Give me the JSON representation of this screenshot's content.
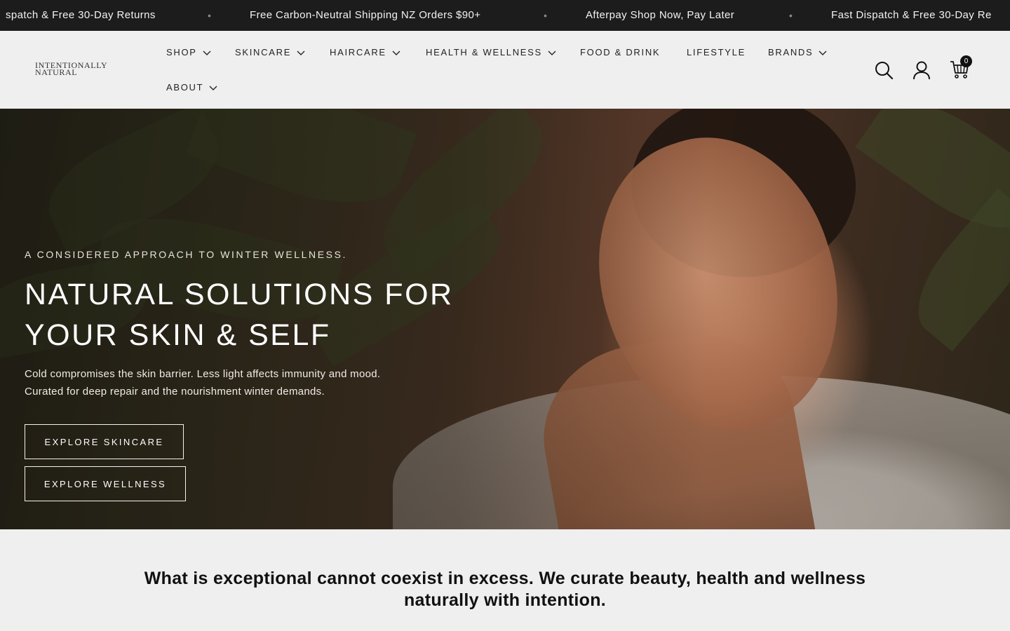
{
  "announcement": {
    "items": [
      "spatch & Free 30-Day Returns",
      "Free Carbon-Neutral Shipping NZ Orders $90+",
      "Afterpay Shop Now, Pay Later",
      "Fast Dispatch & Free 30-Day Re"
    ],
    "separator": "•"
  },
  "header": {
    "logo_line1": "INTENTIONALLY",
    "logo_line2": "NATURAL",
    "nav": [
      {
        "label": "SHOP"
      },
      {
        "label": "SKINCARE"
      },
      {
        "label": "HAIRCARE"
      },
      {
        "label": "HEALTH & WELLNESS"
      },
      {
        "label": "FOOD & DRINK"
      },
      {
        "label": "LIFESTYLE"
      },
      {
        "label": "BRANDS"
      },
      {
        "label": "ABOUT"
      }
    ],
    "icons": [
      "search-icon",
      "account-icon",
      "cart-icon"
    ],
    "cart_count": "0"
  },
  "hero": {
    "eyebrow": "A CONSIDERED APPROACH TO WINTER WELLNESS.",
    "title_line1": "NATURAL SOLUTIONS FOR",
    "title_line2": "YOUR SKIN & SELF",
    "description": "Cold compromises the skin barrier. Less light affects immunity and mood. Curated for deep repair and the nourishment winter demands.",
    "button_skincare": "EXPLORE SKINCARE",
    "button_wellness": "EXPLORE WELLNESS"
  },
  "statement": {
    "text": "What is exceptional cannot coexist in excess. We curate beauty, health and wellness naturally with intention."
  },
  "colors": {
    "announcement_bg": "#1c1c1c",
    "page_bg": "#efefef",
    "text_dark": "#111111"
  }
}
